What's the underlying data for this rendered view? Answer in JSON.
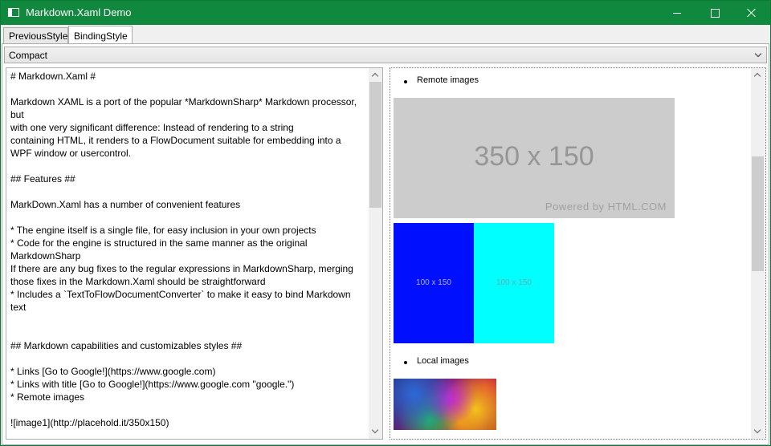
{
  "window": {
    "title": "Markdown.Xaml Demo"
  },
  "tabs": [
    {
      "label": "PreviousStyle",
      "selected": false
    },
    {
      "label": "BindingStyle",
      "selected": true
    }
  ],
  "style_combo": {
    "selected": "Compact"
  },
  "editor": {
    "lines": [
      "# Markdown.Xaml #",
      "",
      "Markdown XAML is a port of the popular *MarkdownSharp* Markdown processor,",
      "but",
      "with one very significant difference: Instead of rendering to a string",
      "containing HTML, it renders to a FlowDocument suitable for embedding into a",
      "WPF window or usercontrol.",
      "",
      "## Features ##",
      "",
      "MarkDown.Xaml has a number of convenient features",
      "",
      "* The engine itself is a single file, for easy inclusion in your own projects",
      "* Code for the engine is structured in the same manner as the original",
      "MarkdownSharp",
      "If there are any bug fixes to the regular expressions in MarkdownSharp, merging",
      "those fixes in the Markdown.Xaml should be straightforward",
      "* Includes a `TextToFlowDocumentConverter` to make it easy to bind Markdown",
      "text",
      "",
      "",
      "## Markdown capabilities and customizables styles ##",
      "",
      "* Links [Go to Google!](https://www.google.com)",
      "* Links with title [Go to Google!](https://www.google.com \"google.\")",
      "* Remote images",
      "",
      "![image1](http://placehold.it/350x150)"
    ]
  },
  "preview": {
    "remote_images_label": "Remote images",
    "local_images_label": "Local images",
    "placeholder_large": {
      "label": "350 x 150",
      "powered_by": "Powered by HTML.COM"
    },
    "placeholder_small": [
      {
        "label": "100 x 150",
        "color": "#0010ff"
      },
      {
        "label": "100 x 150",
        "color": "#00ffff"
      }
    ]
  },
  "colors": {
    "titlebar": "#10893e"
  }
}
